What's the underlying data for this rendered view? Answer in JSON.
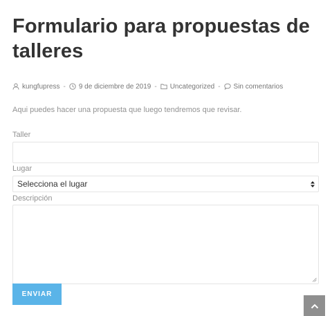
{
  "post": {
    "title": "Formulario para propuestas de talleres",
    "meta": {
      "author": "kungfupress",
      "date": "9 de diciembre de 2019",
      "category": "Uncategorized",
      "comments": "Sin comentarios",
      "separator": "-"
    },
    "intro": "Aqui puedes hacer una propuesta que luego tendremos que revisar."
  },
  "form": {
    "taller_label": "Taller",
    "taller_value": "",
    "lugar_label": "Lugar",
    "lugar_selected": "Selecciona el lugar",
    "descripcion_label": "Descripción",
    "descripcion_value": "",
    "submit_label": "ENVIAR"
  },
  "icons": {
    "author": "user-icon",
    "date": "clock-icon",
    "category": "folder-icon",
    "comments": "comment-icon",
    "scroll_top": "chevron-up-icon"
  },
  "colors": {
    "submit_button": "#5ab4e8",
    "scroll_top_button": "#8f8f8f",
    "title_text": "#333333"
  }
}
